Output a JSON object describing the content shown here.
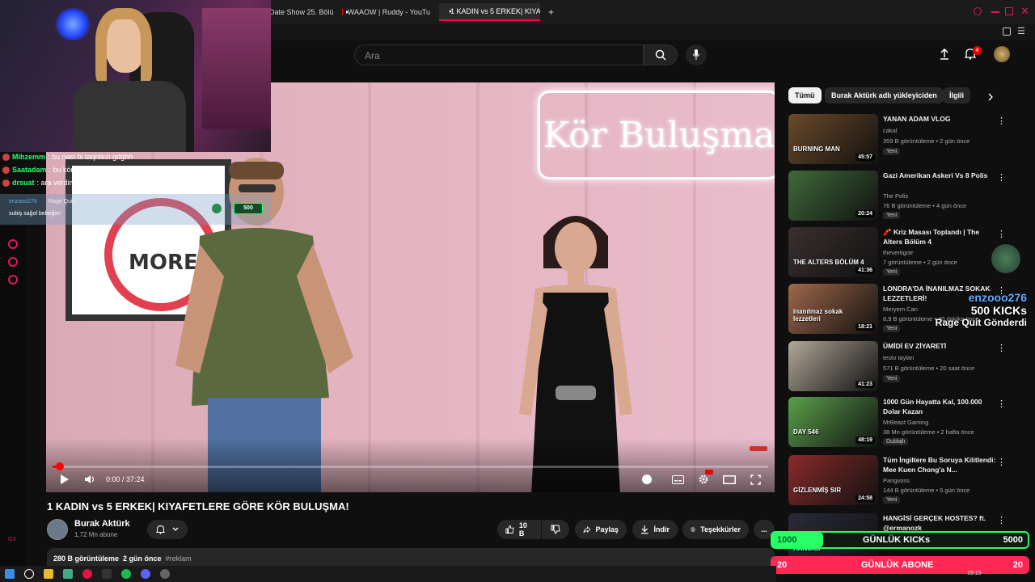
{
  "browser": {
    "tabs": [
      {
        "label": "Date Show 25. Bölü",
        "active": false
      },
      {
        "label": "WAAOW | Ruddy - YouTu",
        "active": false
      },
      {
        "label": "1 KADIN vs 5 ERKEK| KIYA",
        "active": true
      }
    ],
    "new_tab": "+"
  },
  "header": {
    "search_placeholder": "Ara",
    "notification_count": "4"
  },
  "video": {
    "neon_sign": "Kör Buluşma",
    "poster_text": "MORE",
    "time": "0:00 / 37:24",
    "progress": 0.005,
    "title": "1 KADIN vs 5 ERKEK| KIYAFETLERE GÖRE KÖR BULUŞMA!",
    "channel": "Burak Aktürk",
    "subscribers": "1,72 Mn abone",
    "likes": "10 B",
    "share": "Paylaş",
    "download": "İndir",
    "thanks": "Teşekkürler",
    "more": "...",
    "views": "280 B görüntüleme",
    "age": "2 gün önce",
    "hashtag": "#reklam"
  },
  "sidebar": {
    "chips": [
      "Tümü",
      "Burak Aktürk adlı yükleyiciden",
      "İlgili"
    ],
    "recommendations": [
      {
        "title": "YANAN ADAM VLOG",
        "channel": "cakal",
        "meta": "359 B görüntüleme • 2 gün önce",
        "badge": "Yeni",
        "duration": "45:57",
        "thumb": "#6b4a2a",
        "thumb_text": "BURNING MAN"
      },
      {
        "title": "Gazi Amerikan Askeri Vs 8 Polis",
        "channel": "The Polis",
        "meta": "76 B görüntüleme • 4 gün önce",
        "badge": "Yeni",
        "duration": "20:24",
        "thumb": "#3f6a3a",
        "thumb_text": ""
      },
      {
        "title": "🧨 Kriz Masası Toplandı | The Alters Bölüm 4",
        "channel": "thevertigotr",
        "meta": "7 görüntüleme • 2 gün önce",
        "badge": "Yeni",
        "duration": "41:36",
        "thumb": "#3a3030",
        "thumb_text": "THE ALTERS BÖLÜM 4"
      },
      {
        "title": "LONDRA'DA İNANILMAZ SOKAK LEZZETLERİ!",
        "channel": "Meryem Can",
        "meta": "8,9 B görüntüleme • 40 dakika önce",
        "badge": "Yeni",
        "duration": "18:21",
        "thumb": "#a0684a",
        "thumb_text": "inanılmaz sokak lezzetleri"
      },
      {
        "title": "ÜMİDİ EV ZİYARETİ",
        "channel": "testo taylan",
        "meta": "571 B görüntüleme • 20 saat önce",
        "badge": "Yeni",
        "duration": "41:23",
        "thumb": "#b0a898",
        "thumb_text": ""
      },
      {
        "title": "1000 Gün Hayatta Kal, 100.000 Dolar Kazan",
        "channel": "MrBeast Gaming",
        "meta": "38 Mn görüntüleme • 2 hafta önce",
        "badge": "Dublajlı",
        "duration": "48:19",
        "thumb": "#5aa04a",
        "thumb_text": "DAY 546"
      },
      {
        "title": "Tüm İngiltere Bu Soruya Kilitlendi: Mee Kuen Chong'a N...",
        "channel": "Pangvoss",
        "meta": "144 B görüntüleme • 5 gün önce",
        "badge": "Yeni",
        "duration": "24:58",
        "thumb": "#8a2a2a",
        "thumb_text": "GİZLENMİŞ SIR"
      },
      {
        "title": "HANGİSİ GERÇEK HOSTES? ft. @ermanozk",
        "channel": "",
        "meta": "",
        "badge": "",
        "duration": "",
        "thumb": "#2a2a3a",
        "thumb_text": "HANGİSİ"
      }
    ]
  },
  "stream": {
    "chat": [
      {
        "user": "Mihzemm",
        "text": ": bu nasi bi taqntezi gdghh",
        "color": "#2aff6a"
      },
      {
        "user": "Saatadam",
        "text": ": bu kör buluşmadaki kız burayada gelmez inşallah",
        "color": "#2aff6a"
      },
      {
        "user": "drsuat",
        "text": ": ara verdim biraz abd yolculuğu başladı",
        "color": "#2aff6a"
      }
    ],
    "donation_user": "enzooo276",
    "donation_tag": "Rage Quit",
    "donation_msg": "subiş sağol bebeğim",
    "donation_amount": "500",
    "alert_user": "enzooo276",
    "alert_amount": "500 KICKs",
    "alert_text": "Rage Quit Gönderdi",
    "goal_kicks": {
      "current": "1000",
      "label": "GÜNLÜK KICKs",
      "target": "5000",
      "fraction": 0.2
    },
    "goal_subs": {
      "current": "20",
      "label": "GÜNLÜK ABONE",
      "target": "20",
      "fraction": 1.0
    },
    "rail_label": "GX"
  },
  "taskbar": {
    "time": "19:13"
  }
}
